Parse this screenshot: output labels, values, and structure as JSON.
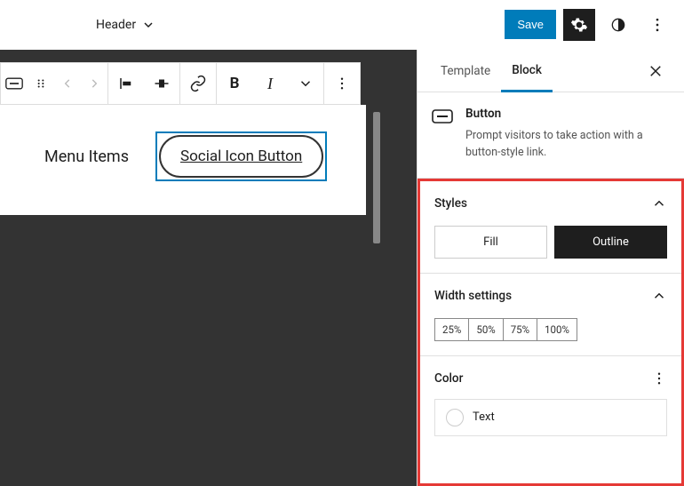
{
  "topbar": {
    "doc_label": "Header",
    "save_label": "Save"
  },
  "toolbar": {
    "icons": [
      "button",
      "drag",
      "prev",
      "next",
      "align-left",
      "align-center",
      "link",
      "bold",
      "italic",
      "more-fmt",
      "options"
    ]
  },
  "canvas": {
    "menu_label": "Menu Items",
    "button_text": "Social Icon Button"
  },
  "sidebar": {
    "tabs": {
      "template": "Template",
      "block": "Block"
    },
    "block": {
      "title": "Button",
      "desc": "Prompt visitors to take action with a button-style link."
    },
    "styles": {
      "heading": "Styles",
      "fill": "Fill",
      "outline": "Outline"
    },
    "width": {
      "heading": "Width settings",
      "opts": [
        "25%",
        "50%",
        "75%",
        "100%"
      ]
    },
    "color": {
      "heading": "Color",
      "text_label": "Text"
    }
  }
}
